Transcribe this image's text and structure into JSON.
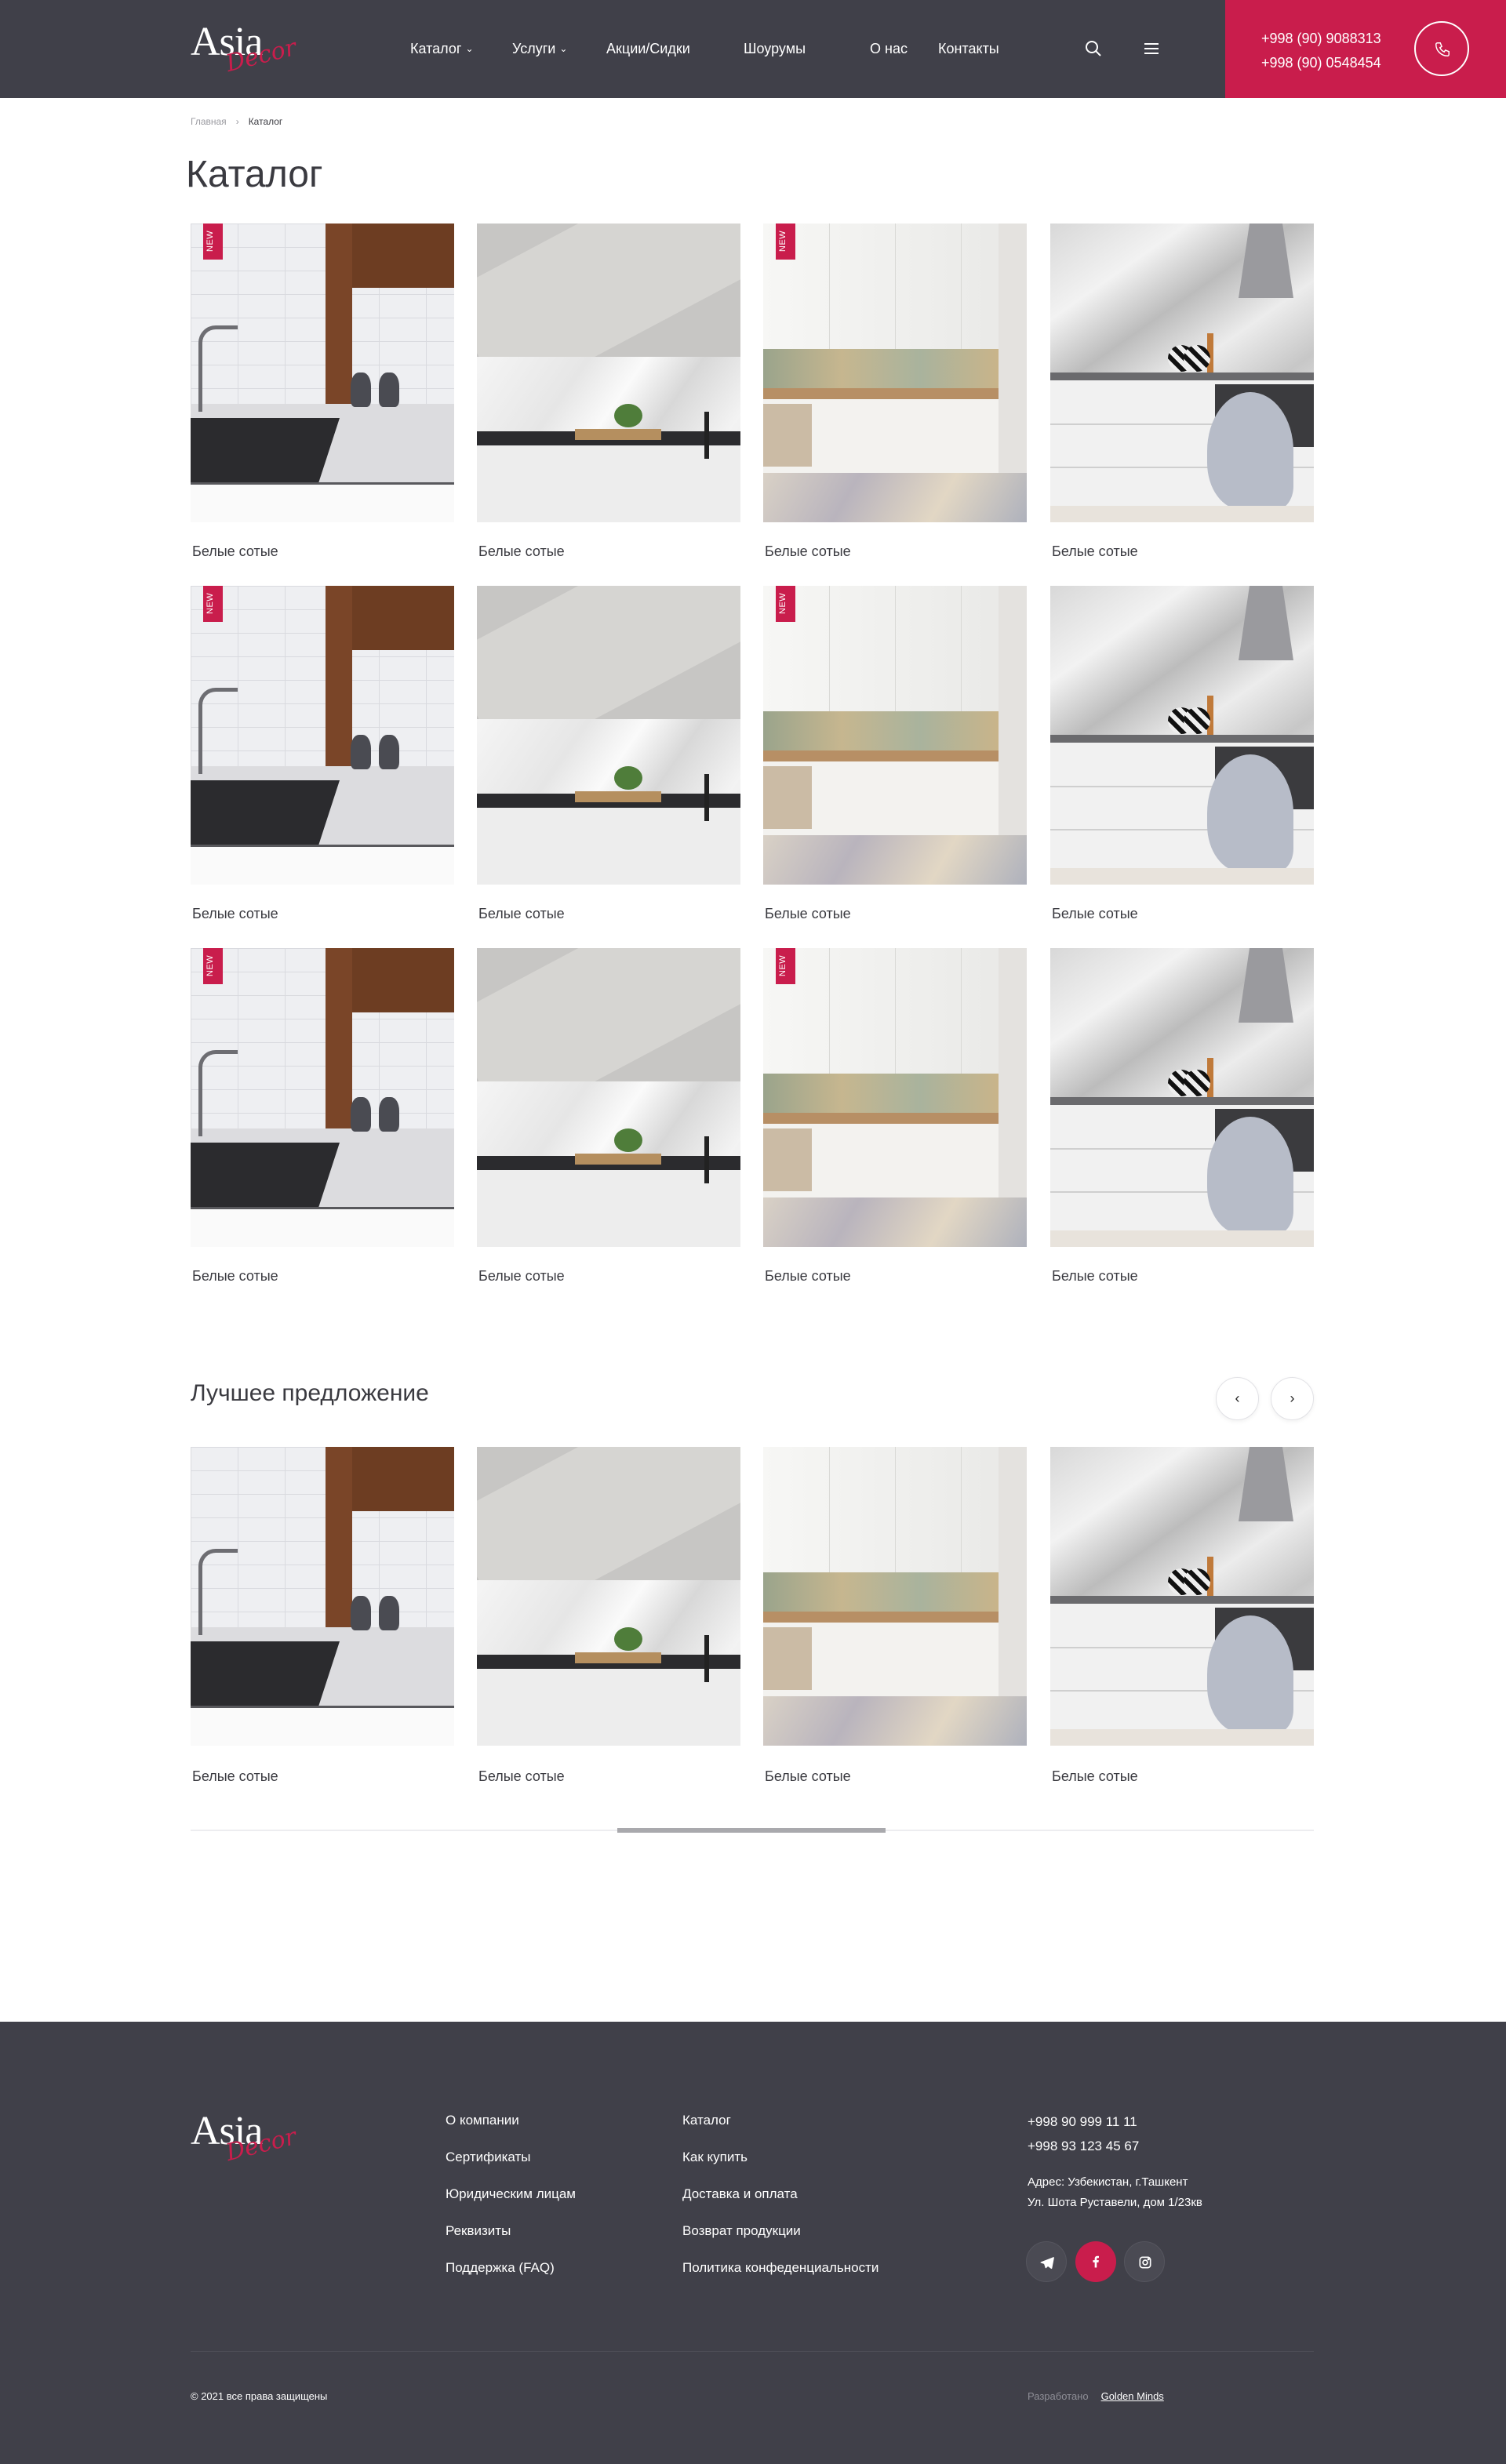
{
  "header": {
    "logo_main": "Asia",
    "logo_script": "Decor",
    "nav": [
      {
        "label": "Каталог",
        "has_dropdown": true
      },
      {
        "label": "Услуги",
        "has_dropdown": true
      },
      {
        "label": "Акции/Сидки",
        "has_dropdown": false
      },
      {
        "label": "Шоурумы",
        "has_dropdown": false
      },
      {
        "label": "О нас",
        "has_dropdown": false
      },
      {
        "label": "Контакты",
        "has_dropdown": false
      }
    ],
    "phones": [
      "+998 (90) 9088313",
      "+998 (90) 0548454"
    ],
    "icons": [
      "search-icon",
      "menu-icon",
      "phone-icon"
    ],
    "accent_color": "#c91d4c",
    "bg_color": "#404049"
  },
  "breadcrumb": {
    "home": "Главная",
    "current": "Каталог"
  },
  "page_title": "Каталог",
  "catalog": {
    "badge": "NEW",
    "items": [
      {
        "name": "Белые сотые",
        "is_new": true
      },
      {
        "name": "Белые сотые",
        "is_new": false
      },
      {
        "name": "Белые сотые",
        "is_new": true
      },
      {
        "name": "Белые сотые",
        "is_new": false
      },
      {
        "name": "Белые сотые",
        "is_new": true
      },
      {
        "name": "Белые сотые",
        "is_new": false
      },
      {
        "name": "Белые сотые",
        "is_new": true
      },
      {
        "name": "Белые сотые",
        "is_new": false
      },
      {
        "name": "Белые сотые",
        "is_new": true
      },
      {
        "name": "Белые сотые",
        "is_new": false
      },
      {
        "name": "Белые сотые",
        "is_new": true
      },
      {
        "name": "Белые сотые",
        "is_new": false
      }
    ]
  },
  "best_offer": {
    "title": "Лучшее предложение",
    "prev_icon": "chevron-left-icon",
    "next_icon": "chevron-right-icon",
    "items": [
      {
        "name": "Белые сотые"
      },
      {
        "name": "Белые сотые"
      },
      {
        "name": "Белые сотые"
      },
      {
        "name": "Белые сотые"
      }
    ]
  },
  "footer": {
    "logo_main": "Asia",
    "logo_script": "Decor",
    "col1": [
      "О компании",
      "Сертификаты",
      "Юридическим лицам",
      "Реквизиты",
      "Поддержка (FAQ)"
    ],
    "col2": [
      "Каталог",
      "Как купить",
      "Доставка и оплата",
      "Возврат продукции",
      "Политика конфеденциальности"
    ],
    "phones": [
      "+998 90 999 11 11",
      "+998 93 123 45 67"
    ],
    "address_line1": "Адрес: Узбекистан, г.Ташкент",
    "address_line2": "Ул. Шота Руставели, дом 1/23кв",
    "social_icons": [
      "telegram-icon",
      "facebook-icon",
      "instagram-icon"
    ],
    "copyright": "© 2021 все права защищены",
    "developed_label": "Разработано",
    "developer": "Golden Minds"
  }
}
